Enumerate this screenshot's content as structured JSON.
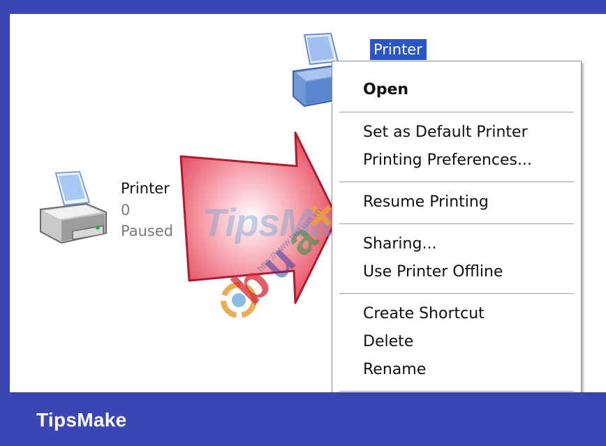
{
  "folder": {
    "printer_left": {
      "name": "Printer",
      "jobs": "0",
      "status": "Paused"
    },
    "printer_top": {
      "name": "Printer"
    }
  },
  "context_menu": {
    "items": [
      {
        "label": "Open",
        "bold": true
      },
      {
        "label": "Set as Default Printer"
      },
      {
        "label": "Printing Preferences..."
      },
      {
        "label": "Resume Printing"
      },
      {
        "label": "Sharing..."
      },
      {
        "label": "Use Printer Offline"
      },
      {
        "label": "Create Shortcut"
      },
      {
        "label": "Delete"
      },
      {
        "label": "Rename"
      }
    ]
  },
  "watermark": {
    "tips_text": "TipsMake",
    "buaxua_text": "buaxua",
    "url_text": "http://www.buaxua.vn"
  },
  "footer": {
    "brand": "TipsMake"
  },
  "colors": {
    "frame_blue": "#3a45b6",
    "selection_blue": "#2a56c8",
    "arrow_red": "#e0334a"
  }
}
